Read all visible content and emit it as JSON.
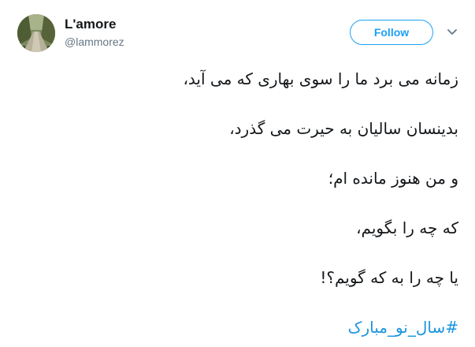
{
  "user": {
    "display_name": "L'amore",
    "handle": "@lammorez"
  },
  "follow_label": "Follow",
  "tweet": {
    "lines": [
      "زمانه می برد ما را سوی بهاری که می آید،",
      "بدینسان سالیان به حیرت می گذرد،",
      "و من هنوز مانده ام؛",
      "که چه را بگویم،",
      "یا چه را به که گویم؟!"
    ],
    "hashtag": "#سال_نو_مبارک"
  },
  "colors": {
    "accent": "#1da1f2",
    "link": "#1b95e0",
    "text": "#14171a",
    "muted": "#657786"
  },
  "icons": {
    "caret": "chevron-down-icon"
  }
}
